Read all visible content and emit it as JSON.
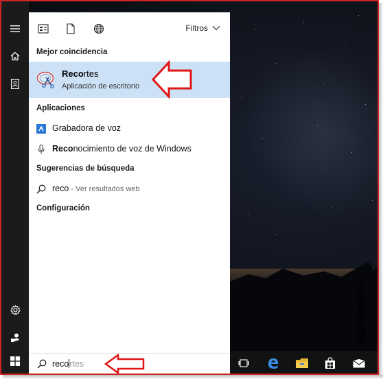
{
  "colors": {
    "highlight": "#cce1f6",
    "annotation_red": "#e01515",
    "rail_bg": "#1b1b1b",
    "frame_border": "#d02424"
  },
  "topbar": {
    "filters_label": "Filtros",
    "icons": [
      "apps-icon",
      "document-icon",
      "globe-icon",
      "chevron-down-icon"
    ]
  },
  "best_match": {
    "section_label": "Mejor coincidencia",
    "title_bold": "Reco",
    "title_rest": "rtes",
    "subtitle": "Aplicación de escritorio",
    "icon": "snipping-tool-icon"
  },
  "apps": {
    "section_label": "Aplicaciones",
    "items": [
      {
        "label_bold": "",
        "label": "Grabadora de voz",
        "icon": "voice-recorder-icon"
      },
      {
        "label_bold": "Reco",
        "label": "nocimiento de voz de Windows",
        "icon": "microphone-icon"
      }
    ]
  },
  "web": {
    "section_label": "Sugerencias de búsqueda",
    "query": "reco",
    "hint": " - Ver resultados web",
    "icon": "search-icon"
  },
  "settings": {
    "section_label": "Configuración"
  },
  "search": {
    "typed": "reco",
    "autocomplete": "rtes"
  },
  "rail": {
    "icons": [
      "hamburger-icon",
      "home-icon",
      "notebook-icon",
      "settings-icon",
      "feedback-icon",
      "windows-start-icon"
    ]
  },
  "taskbar": {
    "icons": [
      "task-view-icon",
      "edge-icon",
      "file-explorer-icon",
      "store-icon",
      "mail-icon"
    ]
  }
}
